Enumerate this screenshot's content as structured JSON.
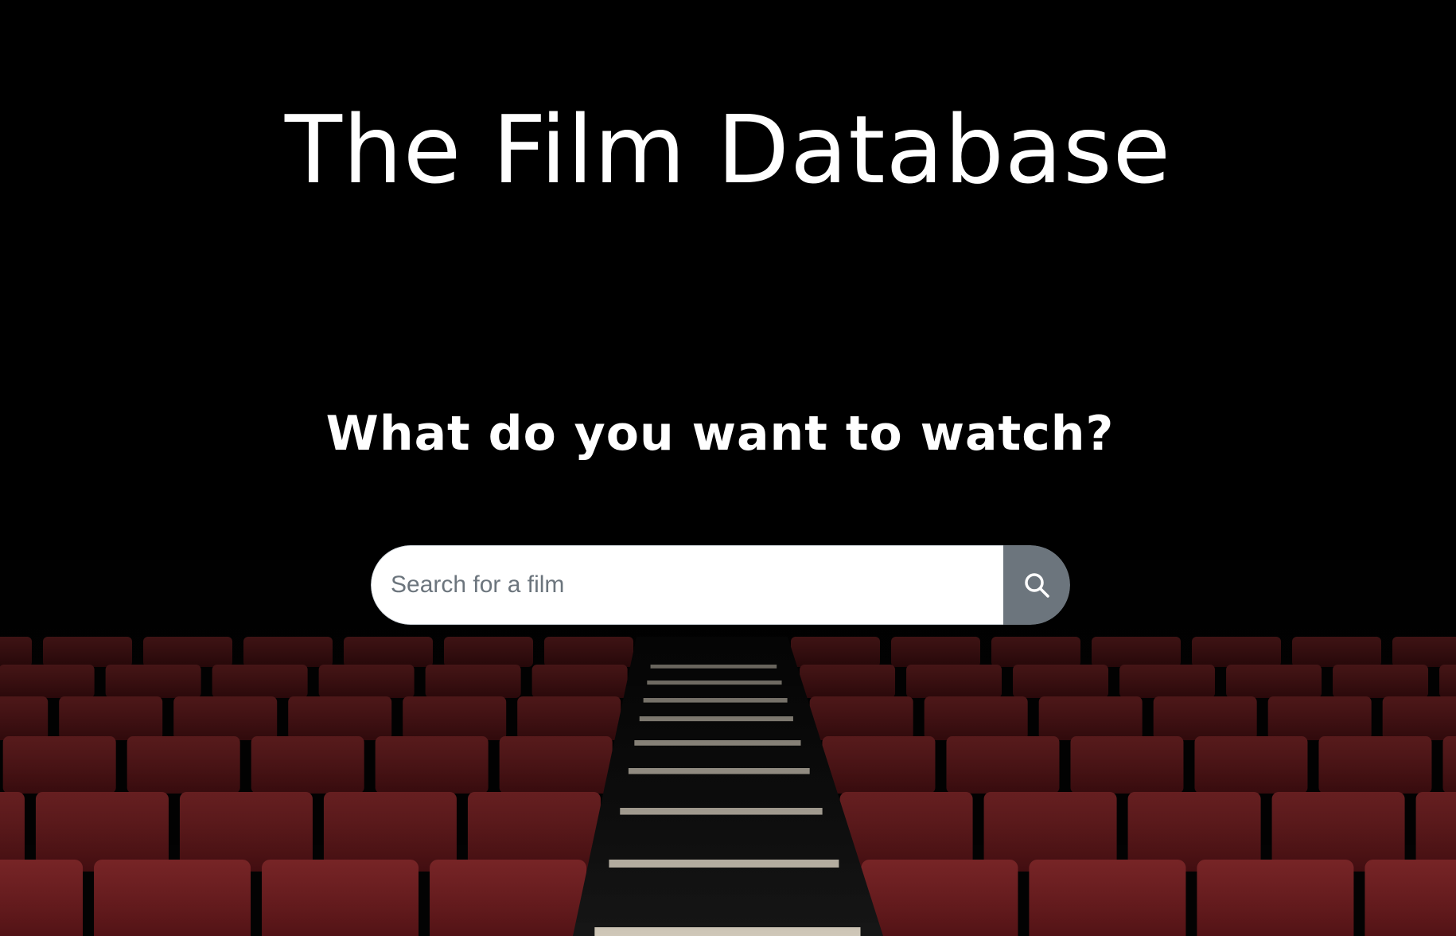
{
  "header": {
    "title": "The Film Database"
  },
  "hero": {
    "prompt": "What do you want to watch?"
  },
  "search": {
    "placeholder": "Search for a film",
    "value": "",
    "button_icon": "search-icon"
  },
  "colors": {
    "background": "#020202",
    "text": "#ffffff",
    "button": "#6c757d",
    "seat": "#6e1a1c"
  }
}
